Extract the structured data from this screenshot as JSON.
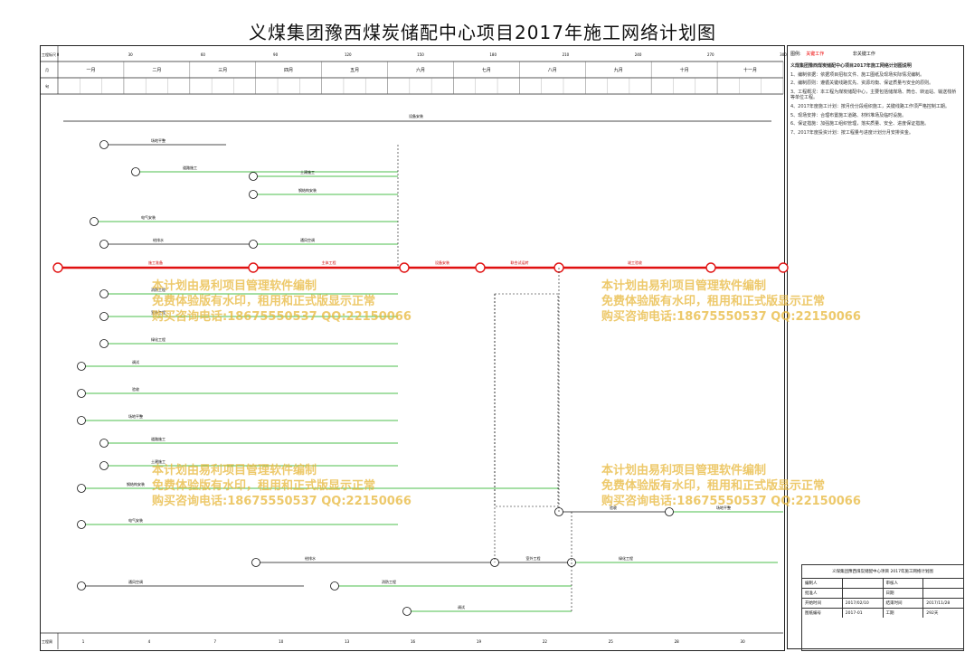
{
  "title": "义煤集团豫西煤炭储配中心项目2017年施工网络计划图",
  "header": {
    "row_day_label": "工程标尺",
    "row_month_label": "月",
    "row_ten_label": "旬",
    "day_ticks": [
      "0",
      "30",
      "60",
      "90",
      "120",
      "150",
      "180",
      "210",
      "240",
      "270",
      "300"
    ],
    "months": [
      "一月",
      "二月",
      "三月",
      "四月",
      "五月",
      "六月",
      "七月",
      "八月",
      "九月",
      "十月",
      "十一月"
    ],
    "bottom_label": "工程周",
    "bottom_ticks": [
      "1",
      "4",
      "7",
      "10",
      "13",
      "16",
      "19",
      "22",
      "25",
      "28",
      "30"
    ]
  },
  "legend": {
    "label": "图例:",
    "items": [
      "关键工作",
      "非关键工作",
      "虚工作",
      "自由时差"
    ]
  },
  "watermark": {
    "line1": "本计划由易利项目管理软件编制",
    "line2": "免费体验版有水印，租用和正式版显示正常",
    "line3": "购买咨询电话:18675550537 QQ:22150066"
  },
  "nodes": [
    "1",
    "2",
    "3",
    "4",
    "5",
    "6",
    "7",
    "8",
    "9",
    "10",
    "11",
    "12",
    "13",
    "14",
    "15",
    "16",
    "17",
    "18",
    "19",
    "20",
    "21",
    "22",
    "23",
    "24",
    "25",
    "26",
    "27",
    "28",
    "29",
    "30",
    "31",
    "32",
    "33",
    "34",
    "35",
    "36",
    "37",
    "38"
  ],
  "tasks": {
    "top": "设备安装",
    "critical": [
      "施工准备",
      "主体工程",
      "设备安装",
      "联合试运转",
      "竣工验收"
    ],
    "misc": [
      "场地平整",
      "道路施工",
      "土建施工",
      "钢结构安装",
      "电气安装",
      "给排水",
      "通风空调",
      "消防工程",
      "室外工程",
      "绿化工程",
      "调试",
      "验收"
    ]
  },
  "notes": {
    "heading": "义煤集团豫西煤炭储配中心项目2017年施工网络计划图说明",
    "paragraphs": [
      "1、编制依据：依据项目招标文件、施工图纸及现场实际情况编制。",
      "2、编制原则：遵循关键线路优先、资源均衡、保证质量与安全的原则。",
      "3、工程概况：本工程为煤炭储配中心，主要包括储煤场、筒仓、转运站、输送栈桥等单位工程。",
      "4、2017年度施工计划：按月份分段组织施工，关键线路工作须严格控制工期。",
      "5、现场安排：合理布置施工道路、材料堆场及临时设施。",
      "6、保证措施：加强施工组织管理，落实质量、安全、进度保证措施。",
      "7、2017年度投资计划：按工程量与进度计划分月安排资金。"
    ]
  },
  "title_block": {
    "org": "义煤集团豫西煤炭储配中心项目",
    "doc": "2017年施工网络计划图",
    "rows": [
      [
        "编制人",
        "",
        "审核人",
        ""
      ],
      [
        "批准人",
        "",
        "日期",
        ""
      ],
      [
        "开始时间",
        "2017/02/10",
        "结束时间",
        "2017/11/28"
      ],
      [
        "图纸编号",
        "2017-01",
        "工期",
        "292天"
      ]
    ]
  }
}
